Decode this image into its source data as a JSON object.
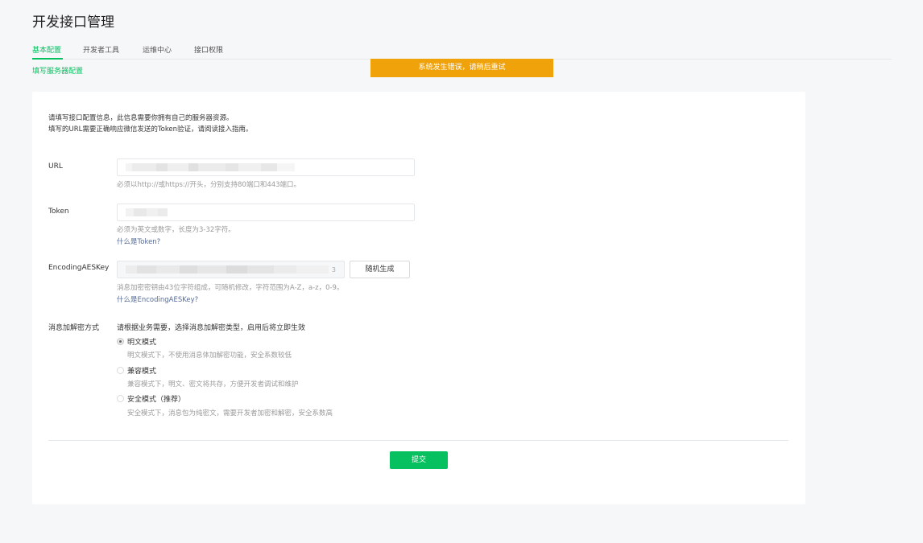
{
  "page": {
    "title": "开发接口管理"
  },
  "tabs": [
    {
      "label": "基本配置",
      "active": true
    },
    {
      "label": "开发者工具",
      "active": false
    },
    {
      "label": "运维中心",
      "active": false
    },
    {
      "label": "接口权限",
      "active": false
    }
  ],
  "sublink": "填写服务器配置",
  "error_banner": "系统发生错误，请稍后重试",
  "intro": {
    "line1": "请填写接口配置信息，此信息需要你拥有自己的服务器资源。",
    "line2": "填写的URL需要正确响应微信发送的Token验证，请阅读接入指南。"
  },
  "form": {
    "url": {
      "label": "URL",
      "hint": "必须以http://或https://开头，分别支持80端口和443端口。"
    },
    "token": {
      "label": "Token",
      "hint": "必须为英文或数字，长度为3-32字符。",
      "help": "什么是Token?"
    },
    "aeskey": {
      "label": "EncodingAESKey",
      "value_tail": "3",
      "hint": "消息加密密钥由43位字符组成，可随机修改，字符范围为A-Z，a-z，0-9。",
      "help": "什么是EncodingAESKey?",
      "random_button": "随机生成"
    },
    "encryption": {
      "label": "消息加解密方式",
      "description": "请根据业务需要，选择消息加解密类型，启用后将立即生效",
      "options": [
        {
          "label": "明文模式",
          "desc": "明文模式下，不使用消息体加解密功能，安全系数较低",
          "checked": true
        },
        {
          "label": "兼容模式",
          "desc": "兼容模式下，明文、密文将共存，方便开发者调试和维护",
          "checked": false
        },
        {
          "label": "安全模式（推荐）",
          "desc": "安全模式下，消息包为纯密文，需要开发者加密和解密，安全系数高",
          "checked": false
        }
      ]
    },
    "submit": "提交"
  },
  "colors": {
    "brand_green": "#07c160",
    "warning_orange": "#f0a20b",
    "link_blue": "#576b95"
  }
}
